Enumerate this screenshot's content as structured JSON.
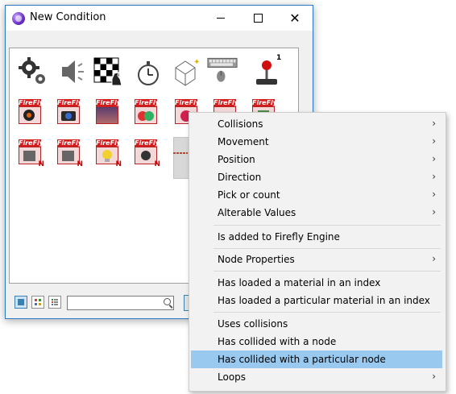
{
  "window": {
    "title": "New Condition"
  },
  "panel": {
    "toolbar_icons": [
      "settings-gears-icon",
      "speaker-icon",
      "chess-board-icon",
      "stopwatch-icon",
      "cube-wand-icon",
      "keyboard-mouse-icon",
      "joystick-icon"
    ],
    "joystick_badge": "1",
    "firefly_label": "FireFly",
    "n_badge": "N"
  },
  "search": {
    "value": "",
    "placeholder": ""
  },
  "menu": {
    "items": [
      {
        "label": "Collisions",
        "submenu": true
      },
      {
        "label": "Movement",
        "submenu": true
      },
      {
        "label": "Position",
        "submenu": true
      },
      {
        "label": "Direction",
        "submenu": true
      },
      {
        "label": "Pick or count",
        "submenu": true
      },
      {
        "label": "Alterable Values",
        "submenu": true
      },
      {
        "label": "Is added to Firefly Engine",
        "submenu": false
      },
      {
        "label": "Node Properties",
        "submenu": true
      },
      {
        "label": "Has loaded a material in an index",
        "submenu": false
      },
      {
        "label": "Has loaded a particular material in an index",
        "submenu": false
      },
      {
        "label": "Uses collisions",
        "submenu": false
      },
      {
        "label": "Has collided with a node",
        "submenu": false
      },
      {
        "label": "Has collided with a particular node",
        "submenu": false,
        "highlighted": true
      },
      {
        "label": "Loops",
        "submenu": true
      }
    ],
    "chevron": "›"
  },
  "colors": {
    "accent": "#2b78c5",
    "highlight": "#99c9ef",
    "firefly_red": "#d51c1c"
  }
}
